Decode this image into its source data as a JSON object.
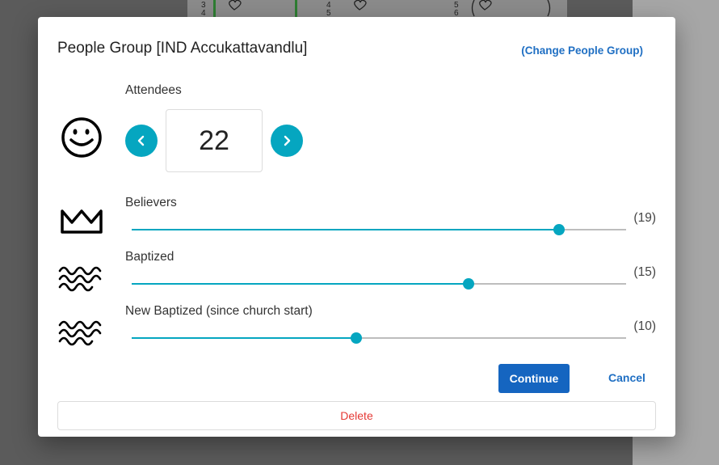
{
  "background": {
    "strip_numbers": [
      "3",
      "4",
      "4",
      "5",
      "5",
      "6"
    ]
  },
  "dialog": {
    "title": "People Group [IND Accukattavandlu]",
    "change_link": "(Change People Group)",
    "attendees": {
      "label": "Attendees",
      "value": "22",
      "icon": "smiley-face-icon",
      "decrement_icon": "chevron-left-icon",
      "increment_icon": "chevron-right-icon"
    },
    "sliders": [
      {
        "label": "Believers",
        "value_text": "(19)",
        "value": 19,
        "max": 22,
        "icon": "crown-icon"
      },
      {
        "label": "Baptized",
        "value_text": "(15)",
        "value": 15,
        "max": 22,
        "icon": "water-waves-icon"
      },
      {
        "label": "New Baptized (since church start)",
        "value_text": "(10)",
        "value": 10,
        "max": 22,
        "icon": "water-waves-icon"
      }
    ],
    "continue_label": "Continue",
    "cancel_label": "Cancel",
    "delete_label": "Delete"
  },
  "colors": {
    "accent": "#05a6c0",
    "primary_button": "#1565c0",
    "link": "#1f6fc3",
    "danger": "#e53935"
  }
}
